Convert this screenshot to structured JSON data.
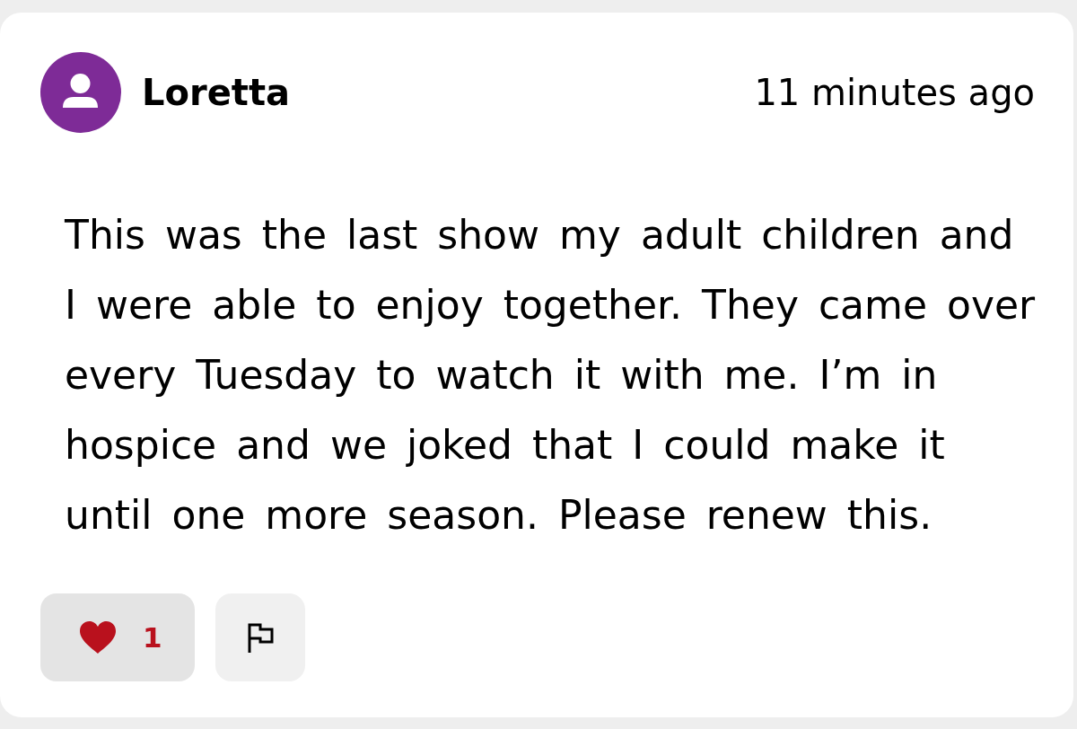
{
  "comment": {
    "author": "Loretta",
    "time": "11 minutes ago",
    "text": "This was the last show my adult children and I were able to enjoy together. They came over every Tuesday to watch it with me. I’m in hospice and we joked that I could make it until one more season. Please renew this.",
    "actions": [
      {
        "kind": "like",
        "count": "1",
        "selected": true
      },
      {
        "kind": "flag",
        "selected": false
      }
    ]
  }
}
